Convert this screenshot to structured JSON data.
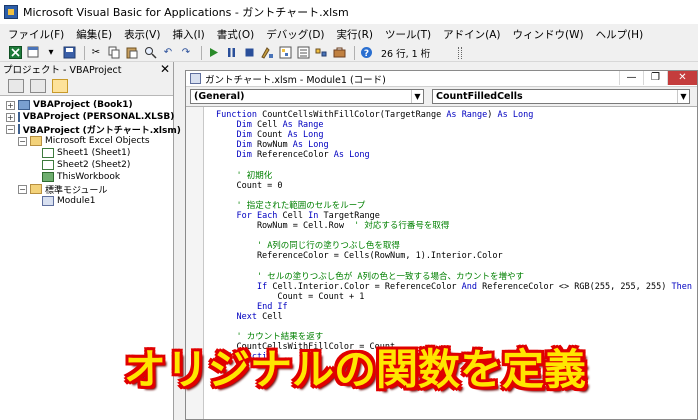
{
  "window": {
    "title": "Microsoft Visual Basic for Applications - ガントチャート.xlsm"
  },
  "menu": [
    "ファイル(F)",
    "編集(E)",
    "表示(V)",
    "挿入(I)",
    "書式(O)",
    "デバッグ(D)",
    "実行(R)",
    "ツール(T)",
    "アドイン(A)",
    "ウィンドウ(W)",
    "ヘルプ(H)"
  ],
  "toolbar": {
    "icons": [
      "excel-icon",
      "insert-module-icon",
      "save-icon",
      "cut-icon",
      "copy-icon",
      "paste-icon",
      "find-icon",
      "undo-icon",
      "redo-icon",
      "run-icon",
      "break-icon",
      "reset-icon",
      "design-mode-icon",
      "project-explorer-icon",
      "properties-icon",
      "object-browser-icon",
      "toolbox-icon",
      "help-icon"
    ],
    "position": "26 行, 1 桁"
  },
  "project_panel": {
    "title": "プロジェクト - VBAProject",
    "tree": {
      "book1": "VBAProject (Book1)",
      "personal": "VBAProject (PERSONAL.XLSB)",
      "gantt": "VBAProject (ガントチャート.xlsm)",
      "excel_objects": "Microsoft Excel Objects",
      "sheet1": "Sheet1 (Sheet1)",
      "sheet2": "Sheet2 (Sheet2)",
      "thisworkbook": "ThisWorkbook",
      "modules": "標準モジュール",
      "module1": "Module1"
    }
  },
  "code_window": {
    "title": "ガントチャート.xlsm - Module1 (コード)",
    "object_dropdown": "(General)",
    "procedure_dropdown": "CountFilledCells",
    "lines": [
      "Function CountCellsWithFillColor(TargetRange As Range) As Long",
      "    Dim Cell As Range",
      "    Dim Count As Long",
      "    Dim RowNum As Long",
      "    Dim ReferenceColor As Long",
      "",
      "    ' 初期化",
      "    Count = 0",
      "",
      "    ' 指定された範囲のセルをループ",
      "    For Each Cell In TargetRange",
      "        RowNum = Cell.Row  ' 対応する行番号を取得",
      "",
      "        ' A列の同じ行の塗りつぶし色を取得",
      "        ReferenceColor = Cells(RowNum, 1).Interior.Color",
      "",
      "        ' セルの塗りつぶし色が A列の色と一致する場合、カウントを増やす",
      "        If Cell.Interior.Color = ReferenceColor And ReferenceColor <> RGB(255, 255, 255) Then",
      "            Count = Count + 1",
      "        End If",
      "    Next Cell",
      "",
      "    ' カウント結果を返す",
      "    CountCellsWithFillColor = Count",
      "End Function",
      ""
    ]
  },
  "caption": "オリジナルの関数を定義",
  "colors": {
    "keyword": "#0000c0",
    "comment": "#008000",
    "caption_fill": "#ffe600",
    "caption_outline": "#e00000",
    "close_button": "#c43c3c"
  }
}
